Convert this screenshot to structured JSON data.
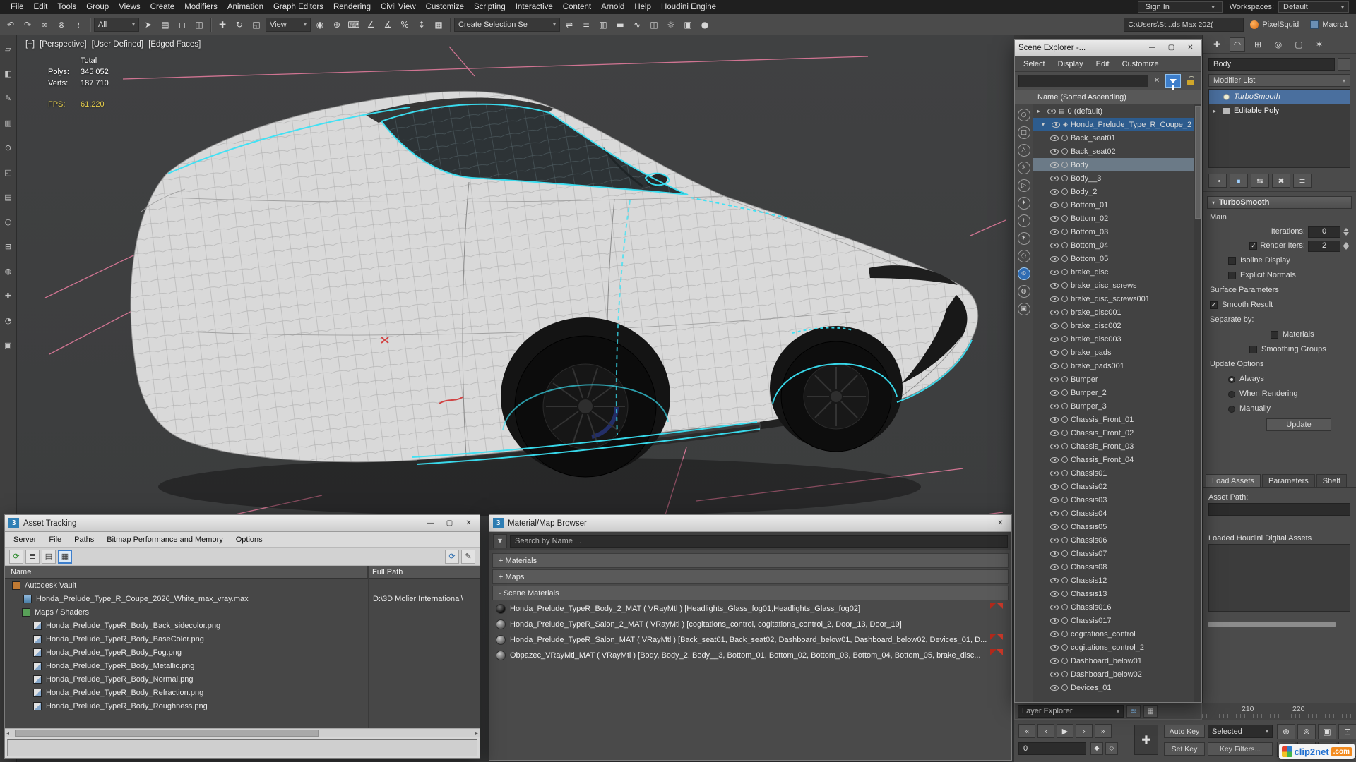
{
  "chrome": {
    "minimize": "—",
    "maximize": "▢",
    "close": "✕",
    "caret_down": "▾",
    "clear": "✕",
    "search_arrow": "▼",
    "left_arrow": "◂",
    "right_arrow": "▸"
  },
  "menubar": {
    "items": [
      "File",
      "Edit",
      "Tools",
      "Group",
      "Views",
      "Create",
      "Modifiers",
      "Animation",
      "Graph Editors",
      "Rendering",
      "Civil View",
      "Customize",
      "Scripting",
      "Interactive",
      "Content",
      "Arnold",
      "Help",
      "Houdini Engine"
    ],
    "sign_in": "Sign In",
    "workspaces_label": "Workspaces:",
    "workspaces_value": "Default"
  },
  "toolbar": {
    "g1": [
      {
        "name": "undo-icon",
        "g": "↶"
      },
      {
        "name": "redo-icon",
        "g": "↷"
      },
      {
        "name": "select-and-link-icon",
        "g": "∞"
      },
      {
        "name": "unlink-selection-icon",
        "g": "⊗"
      },
      {
        "name": "bind-to-spacewarp-icon",
        "g": "≀"
      }
    ],
    "selection_filter_value": "All",
    "g2": [
      {
        "name": "select-object-icon",
        "g": "➤"
      },
      {
        "name": "select-by-name-icon",
        "g": "▤"
      },
      {
        "name": "rectangular-selection-region-icon",
        "g": "◻"
      },
      {
        "name": "window-crossing-icon",
        "g": "◫"
      }
    ],
    "g3": [
      {
        "name": "select-and-move-icon",
        "g": "✚"
      },
      {
        "name": "select-and-rotate-icon",
        "g": "↻"
      },
      {
        "name": "select-and-scale-icon",
        "g": "◱"
      }
    ],
    "reference_coord_value": "View",
    "g4": [
      {
        "name": "use-pivot-center-icon",
        "g": "◉"
      },
      {
        "name": "select-and-manipulate-icon",
        "g": "⊕"
      },
      {
        "name": "keyboard-shortcut-override-icon",
        "g": "⌨"
      },
      {
        "name": "snaps-toggle-icon",
        "g": "∠"
      },
      {
        "name": "angle-snap-icon",
        "g": "∡"
      },
      {
        "name": "percent-snap-icon",
        "g": "%"
      },
      {
        "name": "spinner-snap-icon",
        "g": "↕"
      },
      {
        "name": "named-selection-sets-icon",
        "g": "▦"
      }
    ],
    "named_selection_value": "Create Selection Se",
    "g5": [
      {
        "name": "mirror-icon",
        "g": "⇌"
      },
      {
        "name": "align-icon",
        "g": "≡"
      },
      {
        "name": "layer-explorer-icon",
        "g": "▥"
      },
      {
        "name": "ribbon-icon",
        "g": "▬"
      },
      {
        "name": "curve-editor-icon",
        "g": "∿"
      },
      {
        "name": "schematic-view-icon",
        "g": "◫"
      },
      {
        "name": "render-setup-icon",
        "g": "☼"
      },
      {
        "name": "rendered-frame-icon",
        "g": "▣"
      },
      {
        "name": "render-production-icon",
        "g": "●"
      }
    ],
    "project_path_value": "C:\\Users\\St...ds Max 202(",
    "pixelsquid_label": "PixelSquid",
    "macro_label": "Macro1"
  },
  "leftstrip": {
    "icons": [
      {
        "name": "left-toolbar-icon-1",
        "g": "▱"
      },
      {
        "name": "left-toolbar-icon-2",
        "g": "◧"
      },
      {
        "name": "left-toolbar-icon-3",
        "g": "✎"
      },
      {
        "name": "left-toolbar-icon-4",
        "g": "▥"
      },
      {
        "name": "left-toolbar-icon-5",
        "g": "⊙"
      },
      {
        "name": "left-toolbar-icon-6",
        "g": "◰"
      },
      {
        "name": "left-toolbar-icon-7",
        "g": "▤"
      },
      {
        "name": "left-toolbar-icon-8",
        "g": "○"
      },
      {
        "name": "left-toolbar-icon-9",
        "g": "⊞"
      },
      {
        "name": "left-toolbar-icon-10",
        "g": "◍"
      },
      {
        "name": "left-toolbar-icon-11",
        "g": "✚"
      },
      {
        "name": "left-toolbar-icon-12",
        "g": "◔"
      },
      {
        "name": "left-toolbar-icon-13",
        "g": "▣"
      }
    ]
  },
  "viewport": {
    "header": [
      "[+]",
      "[Perspective]",
      "[User Defined]",
      "[Edged Faces]"
    ],
    "stats": {
      "total_label": "Total",
      "polys_label": "Polys:",
      "polys_value": "345 052",
      "verts_label": "Verts:",
      "verts_value": "187 710",
      "fps_label": "FPS:",
      "fps_value": "61,220"
    }
  },
  "scene_explorer": {
    "title": "Scene Explorer -...",
    "menus": [
      "Select",
      "Display",
      "Edit",
      "Customize"
    ],
    "column_header": "Name (Sorted Ascending)",
    "filters": [
      {
        "name": "display-none-icon",
        "g": "○"
      },
      {
        "name": "display-geometry-icon",
        "g": "□"
      },
      {
        "name": "display-shapes-icon",
        "g": "△"
      },
      {
        "name": "display-lights-icon",
        "g": "☼"
      },
      {
        "name": "display-cameras-icon",
        "g": "▷"
      },
      {
        "name": "display-helpers-icon",
        "g": "✦"
      },
      {
        "name": "display-spacewarps-icon",
        "g": "≀"
      },
      {
        "name": "display-particles-icon",
        "g": "✶"
      },
      {
        "name": "display-bones-icon",
        "g": "◌"
      },
      {
        "name": "display-visibility-icon",
        "g": "⊙",
        "hl": true
      },
      {
        "name": "display-frozen-icon",
        "g": "◍"
      },
      {
        "name": "display-hierarchy-icon",
        "g": "▣"
      }
    ],
    "items": [
      {
        "label": "0 (default)",
        "kind": "layer"
      },
      {
        "label": "Honda_Prelude_Type_R_Coupe_2",
        "kind": "parent",
        "state": "blue"
      },
      {
        "label": "Back_seat01",
        "kind": "obj"
      },
      {
        "label": "Back_seat02",
        "kind": "obj"
      },
      {
        "label": "Body",
        "kind": "obj",
        "state": "gray"
      },
      {
        "label": "Body__3",
        "kind": "obj"
      },
      {
        "label": "Body_2",
        "kind": "obj"
      },
      {
        "label": "Bottom_01",
        "kind": "obj"
      },
      {
        "label": "Bottom_02",
        "kind": "obj"
      },
      {
        "label": "Bottom_03",
        "kind": "obj"
      },
      {
        "label": "Bottom_04",
        "kind": "obj"
      },
      {
        "label": "Bottom_05",
        "kind": "obj"
      },
      {
        "label": "brake_disc",
        "kind": "obj"
      },
      {
        "label": "brake_disc_screws",
        "kind": "obj"
      },
      {
        "label": "brake_disc_screws001",
        "kind": "obj"
      },
      {
        "label": "brake_disc001",
        "kind": "obj"
      },
      {
        "label": "brake_disc002",
        "kind": "obj"
      },
      {
        "label": "brake_disc003",
        "kind": "obj"
      },
      {
        "label": "brake_pads",
        "kind": "obj"
      },
      {
        "label": "brake_pads001",
        "kind": "obj"
      },
      {
        "label": "Bumper",
        "kind": "obj"
      },
      {
        "label": "Bumper_2",
        "kind": "obj"
      },
      {
        "label": "Bumper_3",
        "kind": "obj"
      },
      {
        "label": "Chassis_Front_01",
        "kind": "obj"
      },
      {
        "label": "Chassis_Front_02",
        "kind": "obj"
      },
      {
        "label": "Chassis_Front_03",
        "kind": "obj"
      },
      {
        "label": "Chassis_Front_04",
        "kind": "obj"
      },
      {
        "label": "Chassis01",
        "kind": "obj"
      },
      {
        "label": "Chassis02",
        "kind": "obj"
      },
      {
        "label": "Chassis03",
        "kind": "obj"
      },
      {
        "label": "Chassis04",
        "kind": "obj"
      },
      {
        "label": "Chassis05",
        "kind": "obj"
      },
      {
        "label": "Chassis06",
        "kind": "obj"
      },
      {
        "label": "Chassis07",
        "kind": "obj"
      },
      {
        "label": "Chassis08",
        "kind": "obj"
      },
      {
        "label": "Chassis12",
        "kind": "obj"
      },
      {
        "label": "Chassis13",
        "kind": "obj"
      },
      {
        "label": "Chassis016",
        "kind": "obj"
      },
      {
        "label": "Chassis017",
        "kind": "obj"
      },
      {
        "label": "cogitations_control",
        "kind": "obj"
      },
      {
        "label": "cogitations_control_2",
        "kind": "obj"
      },
      {
        "label": "Dashboard_below01",
        "kind": "obj"
      },
      {
        "label": "Dashboard_below02",
        "kind": "obj"
      },
      {
        "label": "Devices_01",
        "kind": "obj"
      }
    ]
  },
  "layer_bar": {
    "label": "Layer Explorer"
  },
  "command_panel": {
    "tabs": [
      {
        "name": "create-tab-icon",
        "g": "✚"
      },
      {
        "name": "modify-tab-icon",
        "g": "◠",
        "active": true
      },
      {
        "name": "hierarchy-tab-icon",
        "g": "⊞"
      },
      {
        "name": "motion-tab-icon",
        "g": "◎"
      },
      {
        "name": "display-tab-icon",
        "g": "▢"
      },
      {
        "name": "utilities-tab-icon",
        "g": "✶"
      }
    ],
    "object_name": "Body",
    "modifier_list_label": "Modifier List",
    "stack": [
      {
        "label": "TurboSmooth",
        "kind": "ts",
        "state": "sel",
        "caret": ""
      },
      {
        "label": "Editable Poly",
        "kind": "ep",
        "caret": "▸"
      }
    ],
    "stack_buttons": [
      {
        "name": "pin-stack-icon",
        "g": "⊸"
      },
      {
        "name": "show-end-result-icon",
        "g": "∎",
        "hl": true
      },
      {
        "name": "make-unique-icon",
        "g": "⇆"
      },
      {
        "name": "remove-modifier-icon",
        "g": "✖"
      },
      {
        "name": "configure-modifier-sets-icon",
        "g": "≡"
      }
    ],
    "rollout_title": "TurboSmooth",
    "main_label": "Main",
    "iterations_label": "Iterations:",
    "iterations_value": "0",
    "render_iters_label": "Render Iters:",
    "render_iters_value": "2",
    "isoline_label": "Isoline Display",
    "explicit_label": "Explicit Normals",
    "surface_params_label": "Surface Parameters",
    "smooth_result_label": "Smooth Result",
    "separate_by_label": "Separate by:",
    "materials_label": "Materials",
    "smoothing_groups_label": "Smoothing Groups",
    "update_options_label": "Update Options",
    "radio_always": "Always",
    "radio_when_rendering": "When Rendering",
    "radio_manually": "Manually",
    "update_button": "Update",
    "houdini_tabs": [
      {
        "label": "Load Assets",
        "active": true
      },
      {
        "label": "Parameters"
      },
      {
        "label": "Shelf"
      }
    ],
    "asset_path_label": "Asset Path:",
    "loaded_assets_label": "Loaded Houdini Digital Assets"
  },
  "asset_tracking": {
    "title": "Asset Tracking",
    "menus": [
      "Server",
      "File",
      "Paths",
      "Bitmap Performance and Memory",
      "Options"
    ],
    "toolbar_left": [
      {
        "name": "refresh-tracking-icon",
        "g": "⟳",
        "tint": "green"
      },
      {
        "name": "list-view-icon",
        "g": "≣"
      },
      {
        "name": "details-view-icon",
        "g": "▤"
      },
      {
        "name": "table-view-icon",
        "g": "▦",
        "active": true
      }
    ],
    "toolbar_right": [
      {
        "name": "update-assets-icon",
        "g": "⟳",
        "tint": "blue"
      },
      {
        "name": "edit-paths-icon",
        "g": "✎"
      }
    ],
    "columns": [
      "Name",
      "Full Path"
    ],
    "rows": [
      {
        "name": "Autodesk Vault",
        "path": "",
        "kind": "vault"
      },
      {
        "name": "Honda_Prelude_Type_R_Coupe_2026_White_max_vray.max",
        "path": "D:\\3D Molier International\\",
        "kind": "file"
      },
      {
        "name": "Maps / Shaders",
        "path": "",
        "kind": "group"
      },
      {
        "name": "Honda_Prelude_TypeR_Body_Back_sidecolor.png",
        "path": "",
        "kind": "map"
      },
      {
        "name": "Honda_Prelude_TypeR_Body_BaseColor.png",
        "path": "",
        "kind": "map"
      },
      {
        "name": "Honda_Prelude_TypeR_Body_Fog.png",
        "path": "",
        "kind": "map"
      },
      {
        "name": "Honda_Prelude_TypeR_Body_Metallic.png",
        "path": "",
        "kind": "map"
      },
      {
        "name": "Honda_Prelude_TypeR_Body_Normal.png",
        "path": "",
        "kind": "map"
      },
      {
        "name": "Honda_Prelude_TypeR_Body_Refraction.png",
        "path": "",
        "kind": "map"
      },
      {
        "name": "Honda_Prelude_TypeR_Body_Roughness.png",
        "path": "",
        "kind": "map"
      }
    ]
  },
  "material_browser": {
    "title": "Material/Map Browser",
    "search_placeholder": "Search by Name ...",
    "groups": [
      {
        "label": "+ Materials"
      },
      {
        "label": "+ Maps"
      },
      {
        "label": "- Scene Materials"
      }
    ],
    "materials": [
      {
        "label": "Honda_Prelude_TypeR_Body_2_MAT ( VRayMtl ) [Headlights_Glass_fog01,Headlights_Glass_fog02]",
        "flag": true,
        "dark": true
      },
      {
        "label": "Honda_Prelude_TypeR_Salon_2_MAT ( VRayMtl ) [cogitations_control, cogitations_control_2, Door_13, Door_19]"
      },
      {
        "label": "Honda_Prelude_TypeR_Salon_MAT ( VRayMtl ) [Back_seat01, Back_seat02, Dashboard_below01, Dashboard_below02, Devices_01, D...",
        "flag": true
      },
      {
        "label": "Obpazec_VRayMtl_MAT ( VRayMtl ) [Body, Body_2, Body__3, Bottom_01, Bottom_02, Bottom_03, Bottom_04, Bottom_05, brake_disc...",
        "flag": true
      }
    ]
  },
  "bottom_bar": {
    "playback": [
      {
        "name": "go-to-start-icon",
        "g": "«"
      },
      {
        "name": "previous-frame-icon",
        "g": "‹"
      },
      {
        "name": "play-animation-icon",
        "g": "▶"
      },
      {
        "name": "next-frame-icon",
        "g": "›"
      },
      {
        "name": "go-to-end-icon",
        "g": "»"
      }
    ],
    "key_buttons": [
      {
        "name": "key-entry-icon",
        "g": "◆"
      },
      {
        "name": "key-mode-icon",
        "g": "◇"
      }
    ],
    "frame_value": "0",
    "auto_key": "Auto Key",
    "set_key": "Set Key",
    "selected_value": "Selected",
    "key_filters": "Key Filters...",
    "nav": [
      {
        "name": "zoom-icon",
        "g": "⊕"
      },
      {
        "name": "zoom-all-icon",
        "g": "⊚"
      },
      {
        "name": "zoom-extents-icon",
        "g": "▣"
      },
      {
        "name": "zoom-region-icon",
        "g": "⊡"
      },
      {
        "name": "field-of-view-icon",
        "g": "◔"
      },
      {
        "name": "pan-view-icon",
        "g": "✚"
      },
      {
        "name": "orbit-icon",
        "g": "↻"
      },
      {
        "name": "maximize-viewport-icon",
        "g": "◱"
      }
    ],
    "ruler_ticks": [
      "210",
      "220"
    ],
    "watermark_name": "clip2net",
    "watermark_tld": ".com"
  }
}
